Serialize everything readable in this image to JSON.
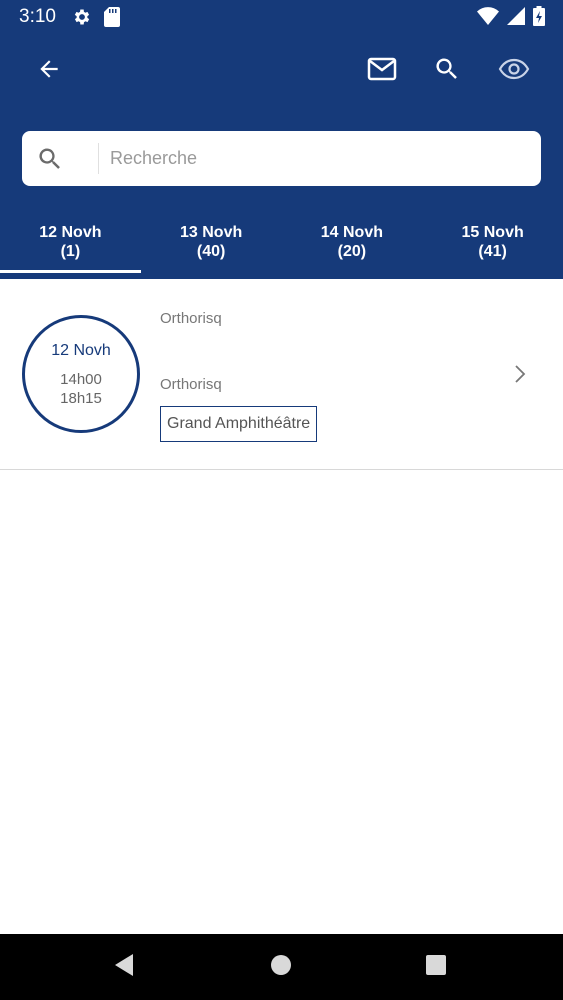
{
  "status_bar": {
    "time": "3:10",
    "icons": [
      "gear-icon",
      "sd-card-icon",
      "wifi-icon",
      "signal-icon",
      "battery-icon"
    ]
  },
  "toolbar": {
    "back_icon": "arrow-left-icon",
    "actions": [
      "mail-icon",
      "search-icon",
      "eye-icon"
    ]
  },
  "search": {
    "placeholder": "Recherche",
    "value": ""
  },
  "tabs": [
    {
      "label": "12 Novh",
      "count": "(1)",
      "active": true
    },
    {
      "label": "13 Novh",
      "count": "(40)",
      "active": false
    },
    {
      "label": "14 Novh",
      "count": "(20)",
      "active": false
    },
    {
      "label": "15 Novh",
      "count": "(41)",
      "active": false
    }
  ],
  "sessions": [
    {
      "date": "12 Novh",
      "start": "14h00",
      "end": "18h15",
      "title": "Orthorisq",
      "subtitle": "Orthorisq",
      "room": "Grand Amphithéâtre"
    }
  ],
  "colors": {
    "primary": "#163a7a",
    "background": "#ffffff",
    "navbar": "#000000"
  },
  "nav_bar": [
    "back-triangle-icon",
    "home-circle-icon",
    "recents-square-icon"
  ]
}
